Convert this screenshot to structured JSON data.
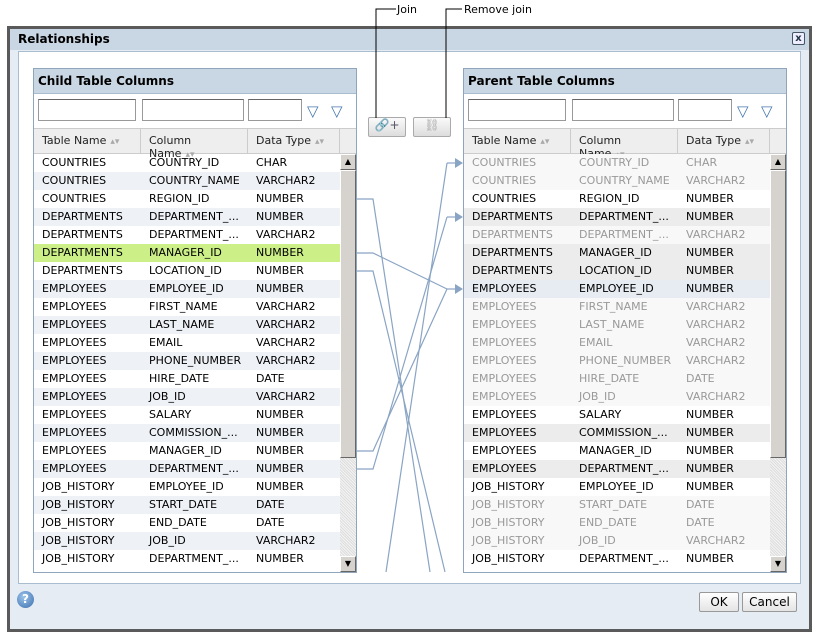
{
  "callouts": {
    "join": "Join",
    "remove_join": "Remove join"
  },
  "dialog": {
    "title": "Relationships"
  },
  "child": {
    "title": "Child Table Columns",
    "columns": [
      "Table Name",
      "Column Name",
      "Data Type"
    ],
    "rows": [
      [
        "COUNTRIES",
        "COUNTRY_ID",
        "CHAR"
      ],
      [
        "COUNTRIES",
        "COUNTRY_NAME",
        "VARCHAR2"
      ],
      [
        "COUNTRIES",
        "REGION_ID",
        "NUMBER"
      ],
      [
        "DEPARTMENTS",
        "DEPARTMENT_...",
        "NUMBER"
      ],
      [
        "DEPARTMENTS",
        "DEPARTMENT_...",
        "VARCHAR2"
      ],
      [
        "DEPARTMENTS",
        "MANAGER_ID",
        "NUMBER"
      ],
      [
        "DEPARTMENTS",
        "LOCATION_ID",
        "NUMBER"
      ],
      [
        "EMPLOYEES",
        "EMPLOYEE_ID",
        "NUMBER"
      ],
      [
        "EMPLOYEES",
        "FIRST_NAME",
        "VARCHAR2"
      ],
      [
        "EMPLOYEES",
        "LAST_NAME",
        "VARCHAR2"
      ],
      [
        "EMPLOYEES",
        "EMAIL",
        "VARCHAR2"
      ],
      [
        "EMPLOYEES",
        "PHONE_NUMBER",
        "VARCHAR2"
      ],
      [
        "EMPLOYEES",
        "HIRE_DATE",
        "DATE"
      ],
      [
        "EMPLOYEES",
        "JOB_ID",
        "VARCHAR2"
      ],
      [
        "EMPLOYEES",
        "SALARY",
        "NUMBER"
      ],
      [
        "EMPLOYEES",
        "COMMISSION_...",
        "NUMBER"
      ],
      [
        "EMPLOYEES",
        "MANAGER_ID",
        "NUMBER"
      ],
      [
        "EMPLOYEES",
        "DEPARTMENT_...",
        "NUMBER"
      ],
      [
        "JOB_HISTORY",
        "EMPLOYEE_ID",
        "NUMBER"
      ],
      [
        "JOB_HISTORY",
        "START_DATE",
        "DATE"
      ],
      [
        "JOB_HISTORY",
        "END_DATE",
        "DATE"
      ],
      [
        "JOB_HISTORY",
        "JOB_ID",
        "VARCHAR2"
      ],
      [
        "JOB_HISTORY",
        "DEPARTMENT_...",
        "NUMBER"
      ]
    ],
    "selected_row": 5
  },
  "parent": {
    "title": "Parent Table Columns",
    "columns": [
      "Table Name",
      "Column Name",
      "Data Type"
    ],
    "rows": [
      [
        "COUNTRIES",
        "COUNTRY_ID",
        "CHAR",
        "dis"
      ],
      [
        "COUNTRIES",
        "COUNTRY_NAME",
        "VARCHAR2",
        "dis"
      ],
      [
        "COUNTRIES",
        "REGION_ID",
        "NUMBER",
        ""
      ],
      [
        "DEPARTMENTS",
        "DEPARTMENT_...",
        "NUMBER",
        "gray"
      ],
      [
        "DEPARTMENTS",
        "DEPARTMENT_...",
        "VARCHAR2",
        "dis"
      ],
      [
        "DEPARTMENTS",
        "MANAGER_ID",
        "NUMBER",
        "gray"
      ],
      [
        "DEPARTMENTS",
        "LOCATION_ID",
        "NUMBER",
        "gray"
      ],
      [
        "EMPLOYEES",
        "EMPLOYEE_ID",
        "NUMBER",
        "hl"
      ],
      [
        "EMPLOYEES",
        "FIRST_NAME",
        "VARCHAR2",
        "dis"
      ],
      [
        "EMPLOYEES",
        "LAST_NAME",
        "VARCHAR2",
        "dis"
      ],
      [
        "EMPLOYEES",
        "EMAIL",
        "VARCHAR2",
        "dis"
      ],
      [
        "EMPLOYEES",
        "PHONE_NUMBER",
        "VARCHAR2",
        "dis"
      ],
      [
        "EMPLOYEES",
        "HIRE_DATE",
        "DATE",
        "dis"
      ],
      [
        "EMPLOYEES",
        "JOB_ID",
        "VARCHAR2",
        "dis"
      ],
      [
        "EMPLOYEES",
        "SALARY",
        "NUMBER",
        ""
      ],
      [
        "EMPLOYEES",
        "COMMISSION_...",
        "NUMBER",
        "gray"
      ],
      [
        "EMPLOYEES",
        "MANAGER_ID",
        "NUMBER",
        ""
      ],
      [
        "EMPLOYEES",
        "DEPARTMENT_...",
        "NUMBER",
        "gray"
      ],
      [
        "JOB_HISTORY",
        "EMPLOYEE_ID",
        "NUMBER",
        ""
      ],
      [
        "JOB_HISTORY",
        "START_DATE",
        "DATE",
        "dis"
      ],
      [
        "JOB_HISTORY",
        "END_DATE",
        "DATE",
        "dis"
      ],
      [
        "JOB_HISTORY",
        "JOB_ID",
        "VARCHAR2",
        "dis"
      ],
      [
        "JOB_HISTORY",
        "DEPARTMENT_...",
        "NUMBER",
        ""
      ]
    ]
  },
  "footer": {
    "ok": "OK",
    "cancel": "Cancel"
  },
  "colors": {
    "accent": "#c9d7e4",
    "selected": "#ccef88",
    "link_line": "#8aa4c4"
  }
}
